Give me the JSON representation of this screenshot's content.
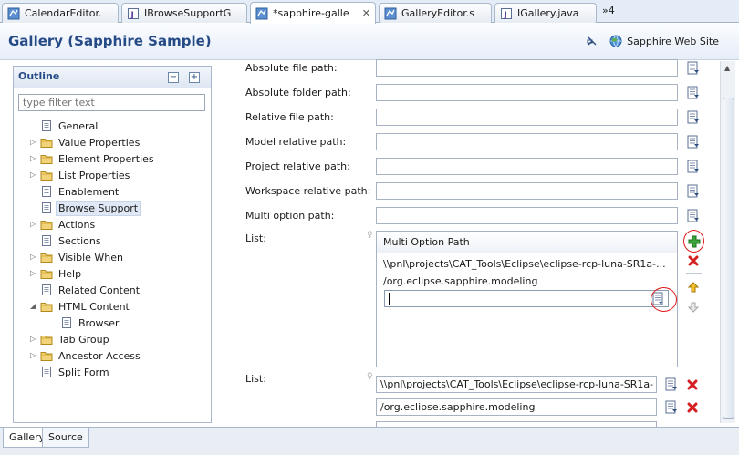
{
  "tabs": [
    {
      "label": "CalendarEditor.",
      "icon": "sapphire-editor-icon"
    },
    {
      "label": "IBrowseSupportG",
      "icon": "java-interface-icon"
    },
    {
      "label": "*sapphire-galle",
      "icon": "sapphire-editor-icon",
      "active": true,
      "close": "✕"
    },
    {
      "label": "GalleryEditor.s",
      "icon": "sapphire-editor-icon"
    },
    {
      "label": "IGallery.java",
      "icon": "java-interface-icon"
    }
  ],
  "tab_overflow": "»4",
  "header": {
    "title": "Gallery (Sapphire Sample)",
    "web_site_label": "Sapphire Web Site"
  },
  "outline": {
    "title": "Outline",
    "collapse_all": "−",
    "expand_all": "+",
    "filter_placeholder": "type filter text",
    "items": [
      {
        "label": "General",
        "icon": "page-icon",
        "expandable": false,
        "level": 0
      },
      {
        "label": "Value Properties",
        "icon": "folder-icon",
        "expandable": true,
        "level": 0
      },
      {
        "label": "Element Properties",
        "icon": "folder-icon",
        "expandable": true,
        "level": 0
      },
      {
        "label": "List Properties",
        "icon": "folder-icon",
        "expandable": true,
        "level": 0
      },
      {
        "label": "Enablement",
        "icon": "page-icon",
        "expandable": false,
        "level": 0
      },
      {
        "label": "Browse Support",
        "icon": "page-icon",
        "expandable": false,
        "level": 0,
        "selected": true
      },
      {
        "label": "Actions",
        "icon": "folder-icon",
        "expandable": true,
        "level": 0
      },
      {
        "label": "Sections",
        "icon": "page-icon",
        "expandable": false,
        "level": 0
      },
      {
        "label": "Visible When",
        "icon": "folder-icon",
        "expandable": true,
        "level": 0
      },
      {
        "label": "Help",
        "icon": "folder-icon",
        "expandable": true,
        "level": 0
      },
      {
        "label": "Related Content",
        "icon": "page-icon",
        "expandable": false,
        "level": 0
      },
      {
        "label": "HTML Content",
        "icon": "folder-icon",
        "expandable": true,
        "expanded": true,
        "level": 0
      },
      {
        "label": "Browser",
        "icon": "page-icon",
        "expandable": false,
        "level": 1
      },
      {
        "label": "Tab Group",
        "icon": "folder-icon",
        "expandable": true,
        "level": 0
      },
      {
        "label": "Ancestor Access",
        "icon": "folder-icon",
        "expandable": true,
        "level": 0
      },
      {
        "label": "Split Form",
        "icon": "page-icon",
        "expandable": false,
        "level": 0
      }
    ]
  },
  "form": {
    "fields": [
      {
        "label": "Absolute file path:",
        "value": ""
      },
      {
        "label": "Absolute folder path:",
        "value": ""
      },
      {
        "label": "Relative file path:",
        "value": ""
      },
      {
        "label": "Model relative path:",
        "value": ""
      },
      {
        "label": "Project relative path:",
        "value": ""
      },
      {
        "label": "Workspace relative path:",
        "value": ""
      },
      {
        "label": "Multi option path:",
        "value": ""
      }
    ],
    "list1": {
      "label": "List:",
      "column_header": "Multi Option Path",
      "rows": [
        "\\\\pnl\\projects\\CAT_Tools\\Eclipse\\eclipse-rcp-luna-SR1a-...",
        "/org.eclipse.sapphire.modeling"
      ],
      "editing_value": ""
    },
    "list2": {
      "label": "List:",
      "rows": [
        "\\\\pnl\\projects\\CAT_Tools\\Eclipse\\eclipse-rcp-luna-SR1a-",
        "/org.eclipse.sapphire.modeling"
      ]
    }
  },
  "bottom_tabs": [
    {
      "label": "Gallery",
      "active": true
    },
    {
      "label": "Source",
      "active": false
    }
  ],
  "colors": {
    "title_blue": "#264a86",
    "annotation_red": "#e01818",
    "add_green": "#3aa53a",
    "delete_red": "#d42020"
  }
}
